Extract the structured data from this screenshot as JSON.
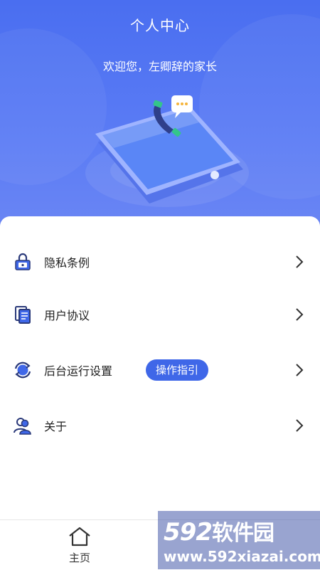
{
  "header": {
    "title": "个人中心",
    "welcome": "欢迎您，左卿辞的家长"
  },
  "menu": [
    {
      "label": "隐私条例",
      "icon": "lock-icon"
    },
    {
      "label": "用户协议",
      "icon": "document-icon"
    },
    {
      "label": "后台运行设置",
      "icon": "refresh-icon",
      "badge": "操作指引"
    },
    {
      "label": "关于",
      "icon": "users-icon"
    }
  ],
  "tabbar": {
    "home_label": "主页"
  },
  "watermark": {
    "logo_num": "592",
    "logo_text": "软件园",
    "url": "www.592xiazai.com"
  },
  "colors": {
    "header": "#4a6ef0",
    "accent": "#3f67e8"
  }
}
